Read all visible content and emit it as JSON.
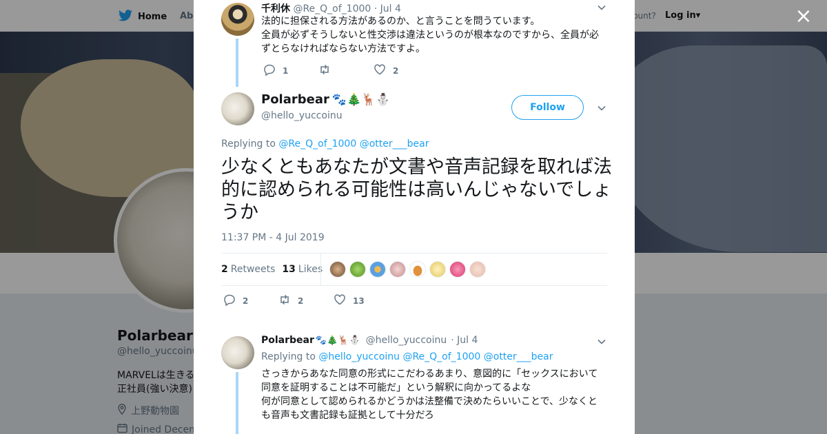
{
  "nav": {
    "home_label": "Home",
    "about_label": "Abo",
    "account_prompt": "ccount?",
    "login_label": "Log in",
    "login_caret": "▾"
  },
  "background_profile": {
    "name": "Polarbear",
    "handle": "@hello_yuccoinu",
    "bio_line1": "MARVELは生きる",
    "bio_line2": "正社員(強い決意)",
    "location": "上野動物園",
    "joined": "Joined Decem"
  },
  "close_label": "×",
  "previous_tweet": {
    "author_name": "千利休",
    "author_handle": "@Re_Q_of_1000",
    "date": "· Jul 4",
    "text_line1": "法的に担保される方法があるのか、と言うことを問うています。",
    "text_line2": "全員が必ずそうしないと性交渉は違法というのが根本なのですから、全員が必",
    "text_line3": "ずとらなければならない方法ですよ。",
    "reply_count": "1",
    "retweet_count": "",
    "like_count": "2"
  },
  "main_tweet": {
    "author_name": "Polarbear",
    "author_emoji": "🐾🎄🦌⛄",
    "author_handle": "@hello_yuccoinu",
    "follow_label": "Follow",
    "replying_prefix": "Replying to",
    "replying_to_1": "@Re_Q_of_1000",
    "replying_to_2": "@otter___bear",
    "text": "少なくともあなたが文書や音声記録を取れば法的に認められる可能性は高いんじゃないでしょうか",
    "timestamp": "11:37 PM - 4 Jul 2019",
    "retweets_count": "2",
    "retweets_label": "Retweets",
    "likes_count": "13",
    "likes_label": "Likes",
    "reply_count": "2",
    "retweet_count": "2",
    "like_count": "13"
  },
  "reply_tweet": {
    "author_name": "Polarbear",
    "author_emoji": "🐾🎄🦌⛄",
    "author_handle": "@hello_yuccoinu",
    "date": "· Jul 4",
    "replying_prefix": "Replying to",
    "replying_to_1": "@hello_yuccoinu",
    "replying_to_2": "@Re_Q_of_1000",
    "replying_to_3": "@otter___bear",
    "text_line1": "さっきからあなた同意の形式にこだわるあまり、意図的に「セックスにおいて",
    "text_line2": "同意を証明することは不可能だ」という解釈に向かってるよな",
    "text_line3": "何が同意として認められるかどうかは法整備で決めたらいいことで、少なくと",
    "text_line4": "も音声も文書記録も証拠として十分だろ"
  },
  "colors": {
    "accent": "#1da1f2",
    "thread_line": "#a8d6f6",
    "muted": "#657786"
  }
}
